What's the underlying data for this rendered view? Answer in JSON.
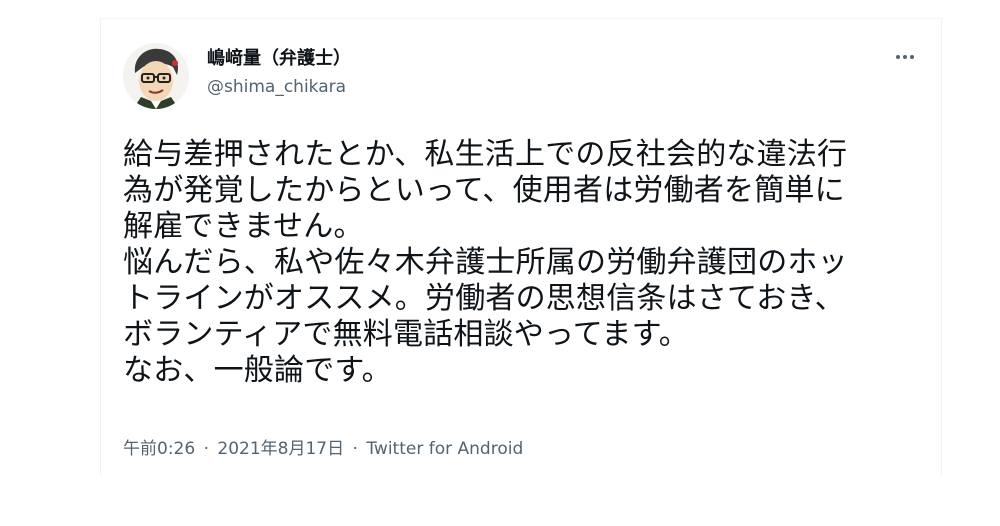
{
  "tweet": {
    "author": {
      "display_name": "嶋﨑量（弁護士）",
      "handle": "@shima_chikara"
    },
    "more_icon": "more-horizontal-icon",
    "body_lines": [
      "給与差押されたとか、私生活上での反社会的な違法行",
      "為が発覚したからといって、使用者は労働者を簡単に",
      "解雇できません。",
      "悩んだら、私や佐々木弁護士所属の労働弁護団のホッ",
      "トラインがオススメ。労働者の思想信条はさておき、",
      "ボランティアで無料電話相談やってます。",
      "なお、一般論です。"
    ],
    "meta": {
      "time": "午前0:26",
      "separator": "·",
      "date": "2021年8月17日",
      "source": "Twitter for Android"
    }
  },
  "colors": {
    "text": "#0f1419",
    "secondary": "#536471",
    "border": "#eff3f4"
  }
}
